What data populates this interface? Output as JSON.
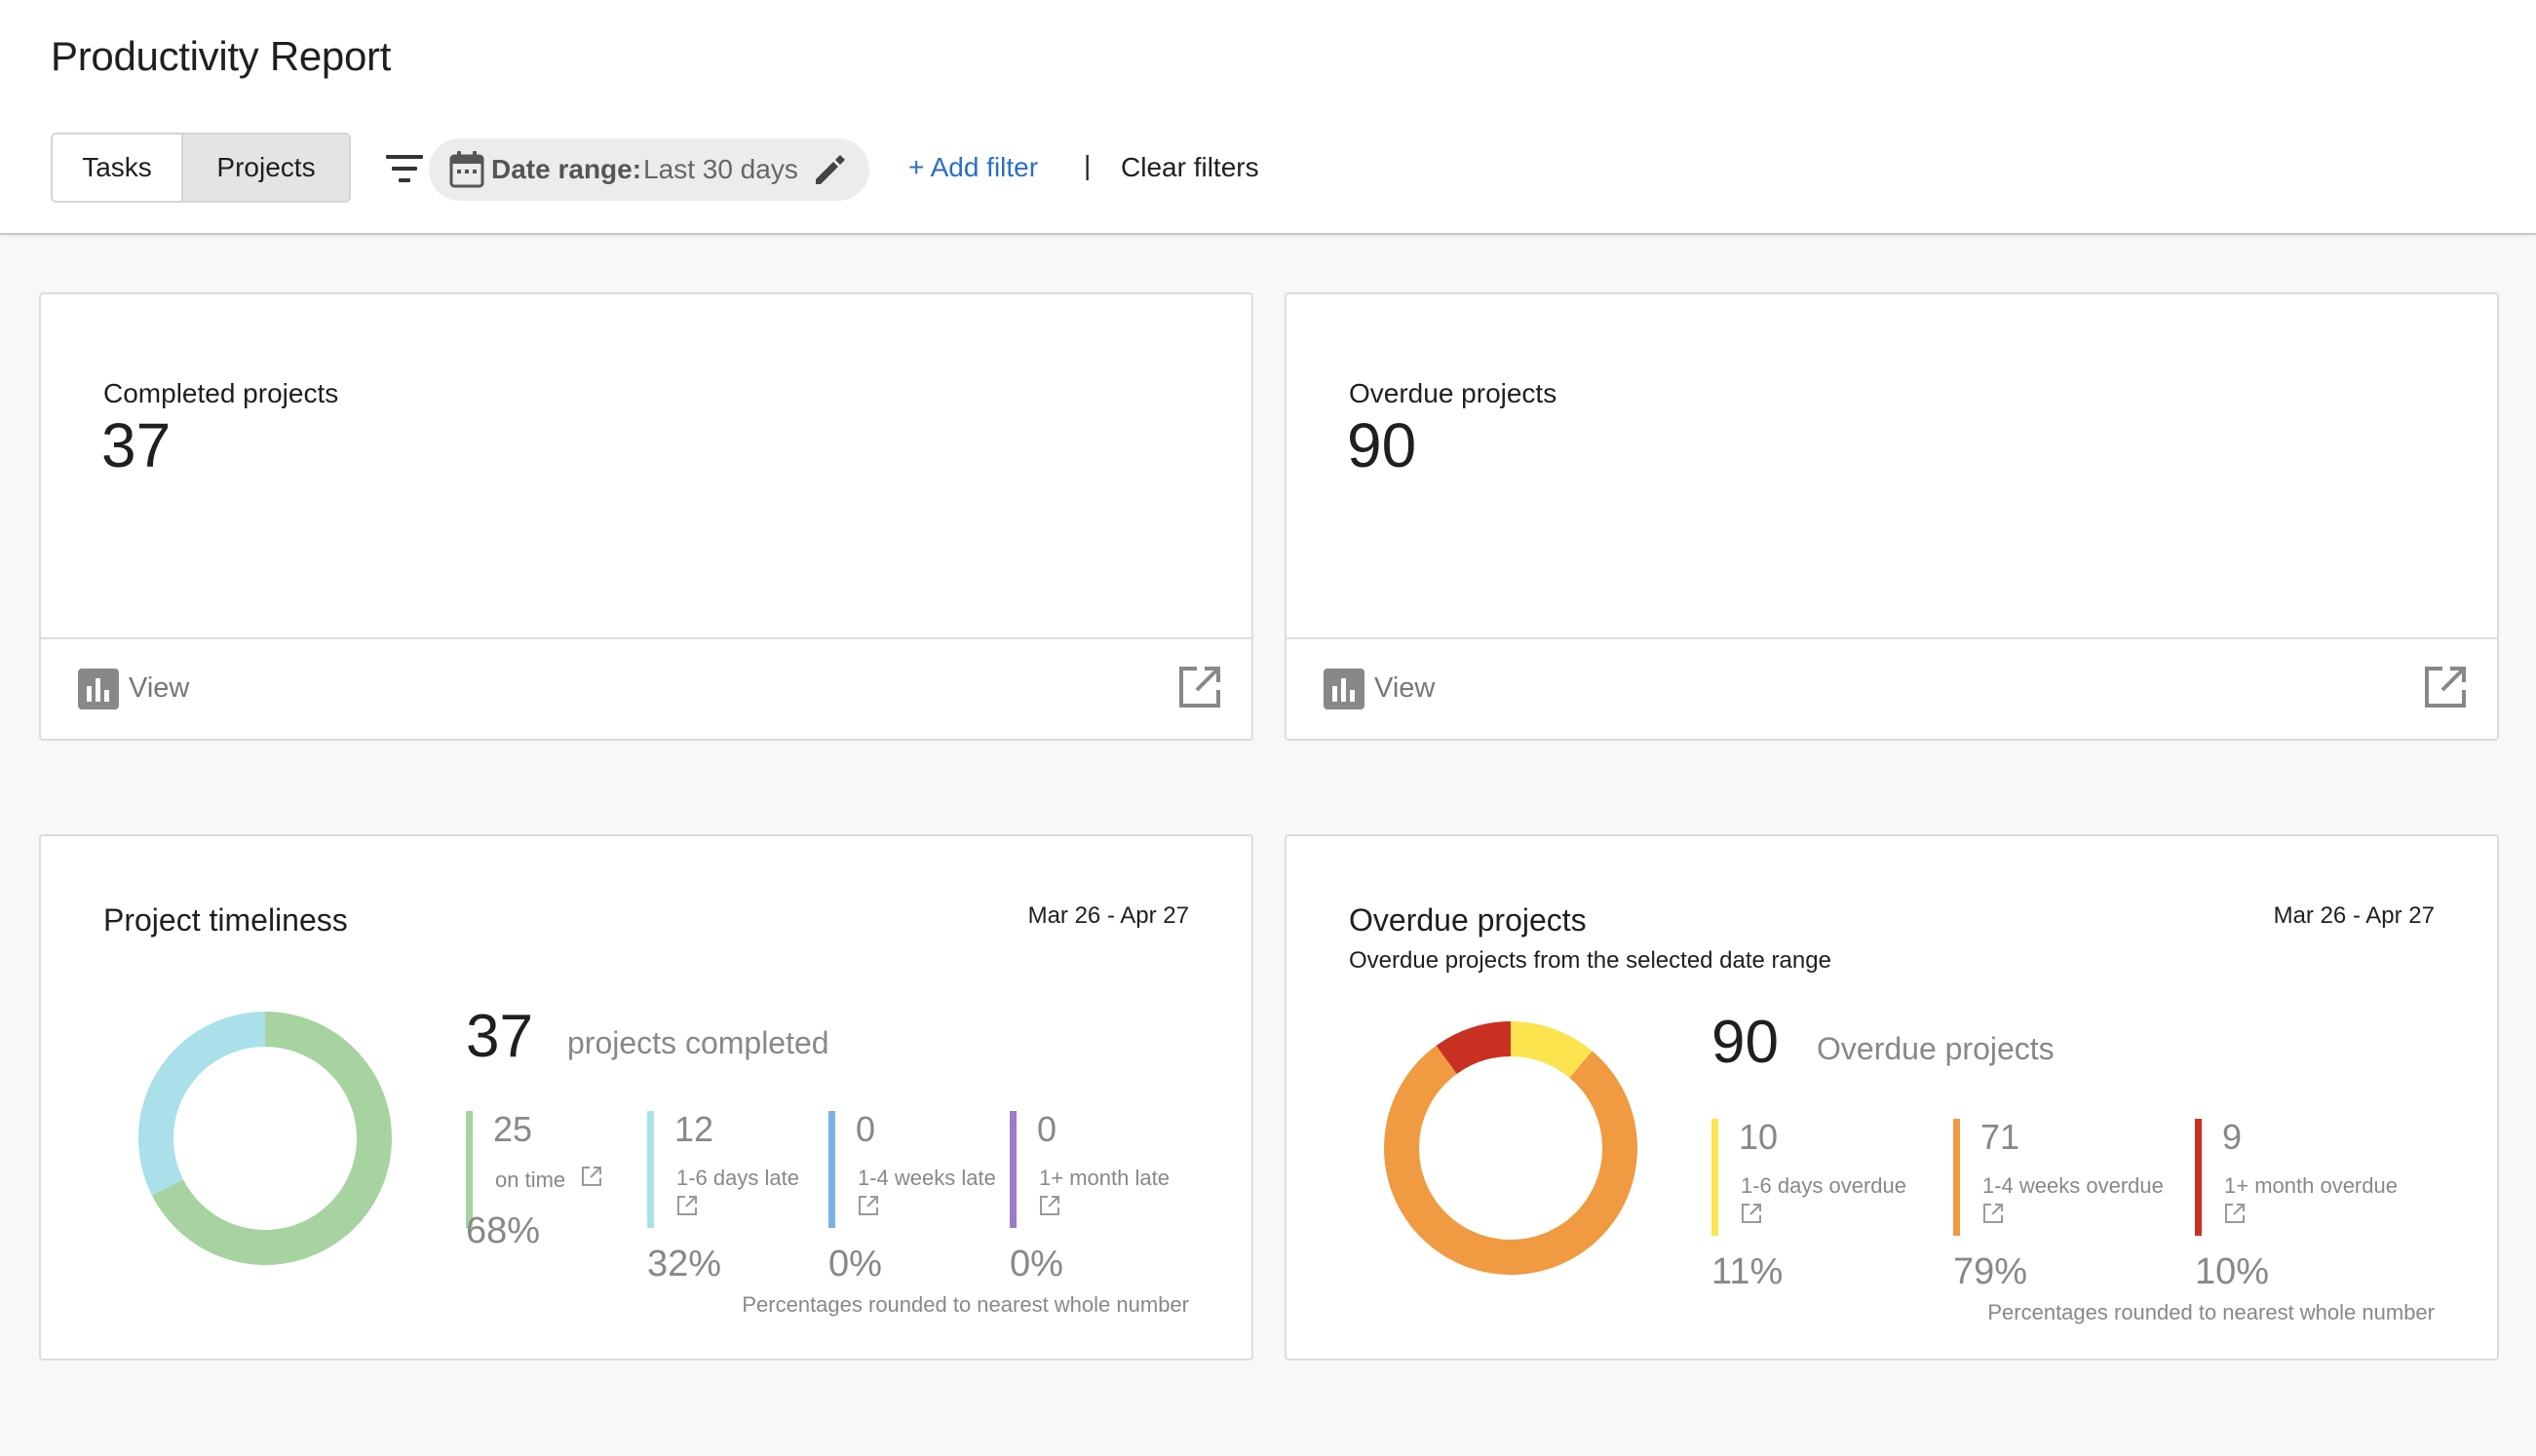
{
  "header": {
    "title": "Productivity Report",
    "tabs": [
      {
        "label": "Tasks",
        "active": false
      },
      {
        "label": "Projects",
        "active": true
      }
    ],
    "filter_chip": {
      "label": "Date range:",
      "value": "Last 30 days"
    },
    "add_filter_label": "+ Add filter",
    "separator": "|",
    "clear_filters_label": "Clear filters"
  },
  "stat_cards": [
    {
      "label": "Completed projects",
      "value": "37",
      "footer_label": "View"
    },
    {
      "label": "Overdue projects",
      "value": "90",
      "footer_label": "View"
    }
  ],
  "timeliness": {
    "title": "Project timeliness",
    "date_range": "Mar 26 - Apr 27",
    "total": "37",
    "total_label": "projects completed",
    "segments": [
      {
        "value": 25,
        "label": "on time",
        "pct": "68%",
        "color": "#a6d39f"
      },
      {
        "value": 12,
        "label": "1-6 days late",
        "pct": "32%",
        "color": "#a9e0ea"
      },
      {
        "value": 0,
        "label": "1-4 weeks late",
        "pct": "0%",
        "color": "#7ab2e6"
      },
      {
        "value": 0,
        "label": "1+ month late",
        "pct": "0%",
        "color": "#9c7bc9"
      }
    ],
    "footnote": "Percentages rounded to nearest whole number"
  },
  "overdue": {
    "title": "Overdue projects",
    "subtitle": "Overdue projects from the selected date range",
    "date_range": "Mar 26 - Apr 27",
    "total": "90",
    "total_label": "Overdue projects",
    "segments": [
      {
        "value": 10,
        "label": "1-6 days overdue",
        "pct": "11%",
        "color": "#fbe44e"
      },
      {
        "value": 71,
        "label": "1-4 weeks overdue",
        "pct": "79%",
        "color": "#f09a41"
      },
      {
        "value": 9,
        "label": "1+ month overdue",
        "pct": "10%",
        "color": "#c83122"
      }
    ],
    "footnote": "Percentages rounded to nearest whole number"
  },
  "icons": {
    "filter": "filter-icon",
    "calendar": "calendar-icon",
    "pencil": "pencil-icon",
    "view": "bar-chart-icon",
    "external": "external-link-icon"
  }
}
